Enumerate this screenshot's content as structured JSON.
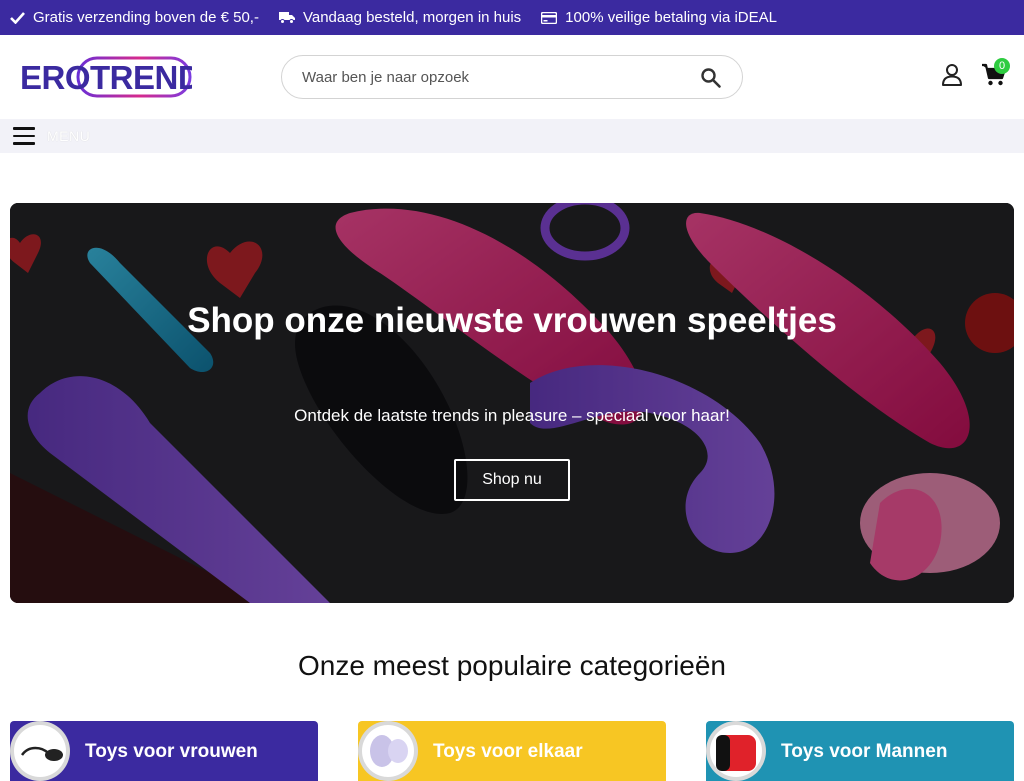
{
  "topbar": {
    "usps": [
      {
        "icon": "check-icon",
        "text": "Gratis verzending boven de € 50,-"
      },
      {
        "icon": "truck-icon",
        "text": "Vandaag besteld, morgen in huis"
      },
      {
        "icon": "credit-card-icon",
        "text": "100% veilige betaling via iDEAL"
      }
    ]
  },
  "header": {
    "logo_text": "EROTREND",
    "search_placeholder": "Waar ben je naar opzoek",
    "cart_count": "0"
  },
  "menubar": {
    "label": "MENU"
  },
  "hero": {
    "title": "Shop onze nieuwste vrouwen speeltjes",
    "subtitle": "Ontdek de laatste trends in pleasure – speciaal voor haar!",
    "button": "Shop nu"
  },
  "categories": {
    "title": "Onze meest populaire categorieën",
    "items": [
      {
        "label": "Toys voor vrouwen",
        "color": "#3b2aa0"
      },
      {
        "label": "Toys voor elkaar",
        "color": "#f7c623"
      },
      {
        "label": "Toys voor Mannen",
        "color": "#1f93b3"
      }
    ]
  },
  "colors": {
    "brand_purple": "#3b2aa0",
    "badge_green": "#2ecc40",
    "logo_magenta": "#d62a8c"
  }
}
